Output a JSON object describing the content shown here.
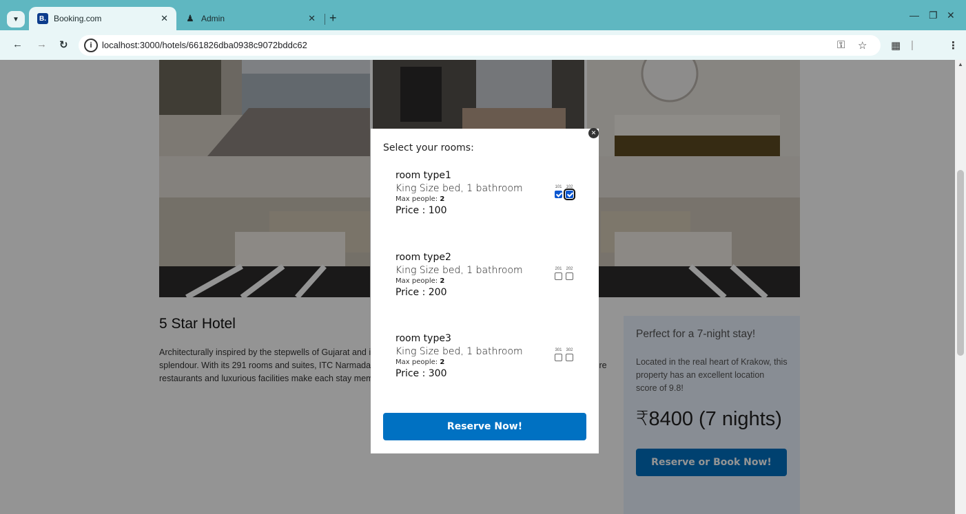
{
  "browser": {
    "tabs": [
      {
        "title": "Booking.com",
        "favicon": "B.",
        "active": true
      },
      {
        "title": "Admin",
        "favicon": "admin-icon",
        "active": false
      }
    ],
    "url": "localhost:3000/hotels/661826dba0938c9072bddc62"
  },
  "hotel": {
    "title": "5 Star Hotel",
    "description": "Architecturally inspired by the stepwells of Gujarat and its iconic façade, ITC Narmada welcomes you with regal splendour. With its 291 rooms and suites, ITC Narmada is a glowing celebration of the culture of Gujarat. Its signature restaurants and luxurious facilities make each stay memorable.",
    "sidebar": {
      "heading": "Perfect for a 7-night stay!",
      "text": "Located in the real heart of Krakow, this property has an excellent location score of 9.8!",
      "price": "₹8400 (7 nights)",
      "button": "Reserve or Book Now!"
    }
  },
  "modal": {
    "heading": "Select your rooms:",
    "rooms": [
      {
        "title": "room type1",
        "desc": "King Size bed, 1 bathroom",
        "max_label": "Max people:",
        "max": "2",
        "price": "Price : 100",
        "numbers": [
          {
            "n": "101",
            "checked": true
          },
          {
            "n": "102",
            "checked": true
          }
        ]
      },
      {
        "title": "room type2",
        "desc": "King Size bed, 1 bathroom",
        "max_label": "Max people:",
        "max": "2",
        "price": "Price : 200",
        "numbers": [
          {
            "n": "201",
            "checked": false
          },
          {
            "n": "202",
            "checked": false
          }
        ]
      },
      {
        "title": "room type3",
        "desc": "King Size bed, 1 bathroom",
        "max_label": "Max people:",
        "max": "2",
        "price": "Price : 300",
        "numbers": [
          {
            "n": "301",
            "checked": false
          },
          {
            "n": "302",
            "checked": false
          }
        ]
      }
    ],
    "reserve_button": "Reserve Now!"
  },
  "colors": {
    "browser_frame": "#5fb7c1",
    "primary_button": "#0071c2",
    "checkbox_checked": "#0b57d0"
  }
}
